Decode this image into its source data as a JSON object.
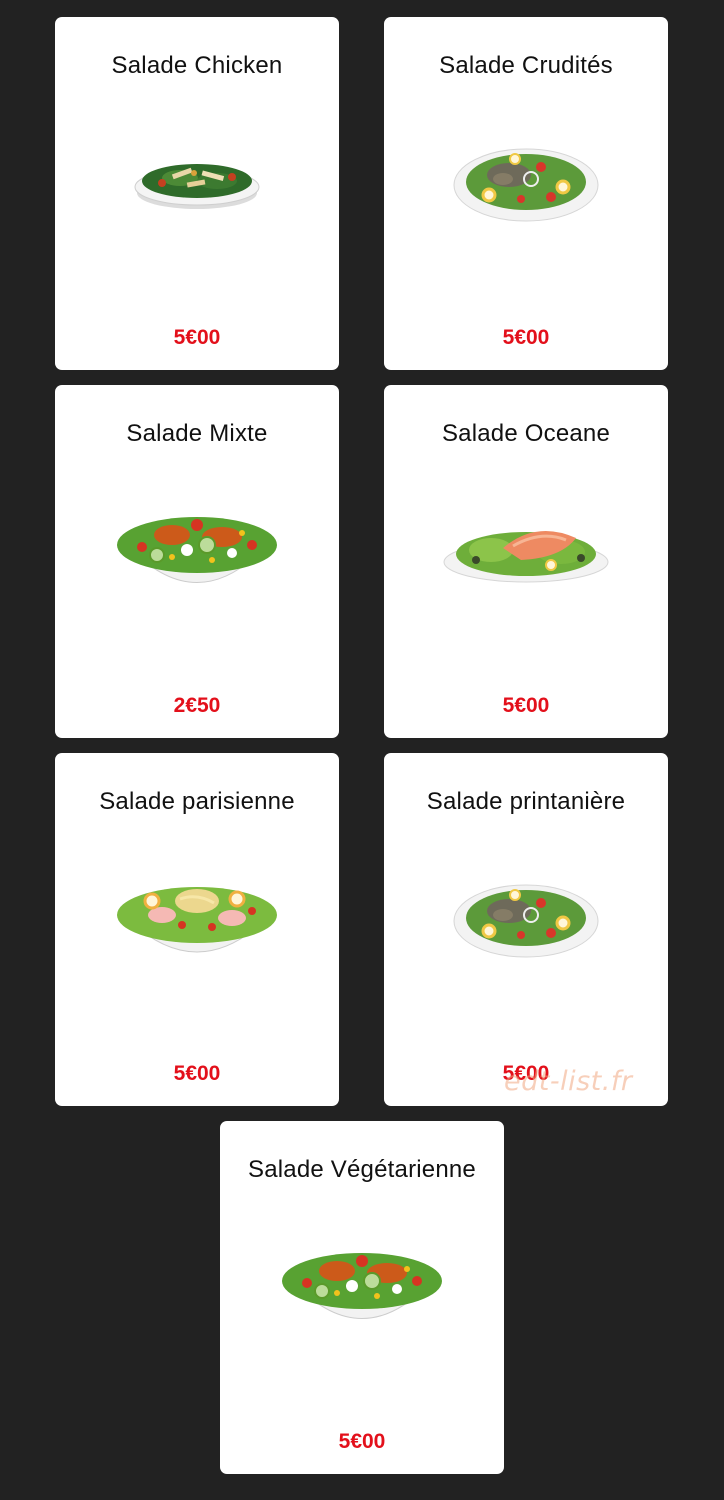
{
  "colors": {
    "background": "#222222",
    "card": "#ffffff",
    "price": "#e3101b",
    "watermark": "#f2a883"
  },
  "menu": {
    "items": [
      {
        "name": "Salade Chicken",
        "price": "5€00",
        "image_icon": "chicken-salad-bowl-icon"
      },
      {
        "name": "Salade Crudités",
        "price": "5€00",
        "image_icon": "crudites-salad-plate-icon"
      },
      {
        "name": "Salade Mixte",
        "price": "2€50",
        "image_icon": "mixed-salad-bowl-icon"
      },
      {
        "name": "Salade Oceane",
        "price": "5€00",
        "image_icon": "salmon-salad-plate-icon"
      },
      {
        "name": "Salade parisienne",
        "price": "5€00",
        "image_icon": "parisian-salad-bowl-icon"
      },
      {
        "name": "Salade printanière",
        "price": "5€00",
        "image_icon": "spring-salad-plate-icon"
      },
      {
        "name": "Salade Végétarienne",
        "price": "5€00",
        "image_icon": "vegetarian-salad-bowl-icon"
      }
    ]
  },
  "watermark": {
    "text": "edt-list.fr"
  }
}
